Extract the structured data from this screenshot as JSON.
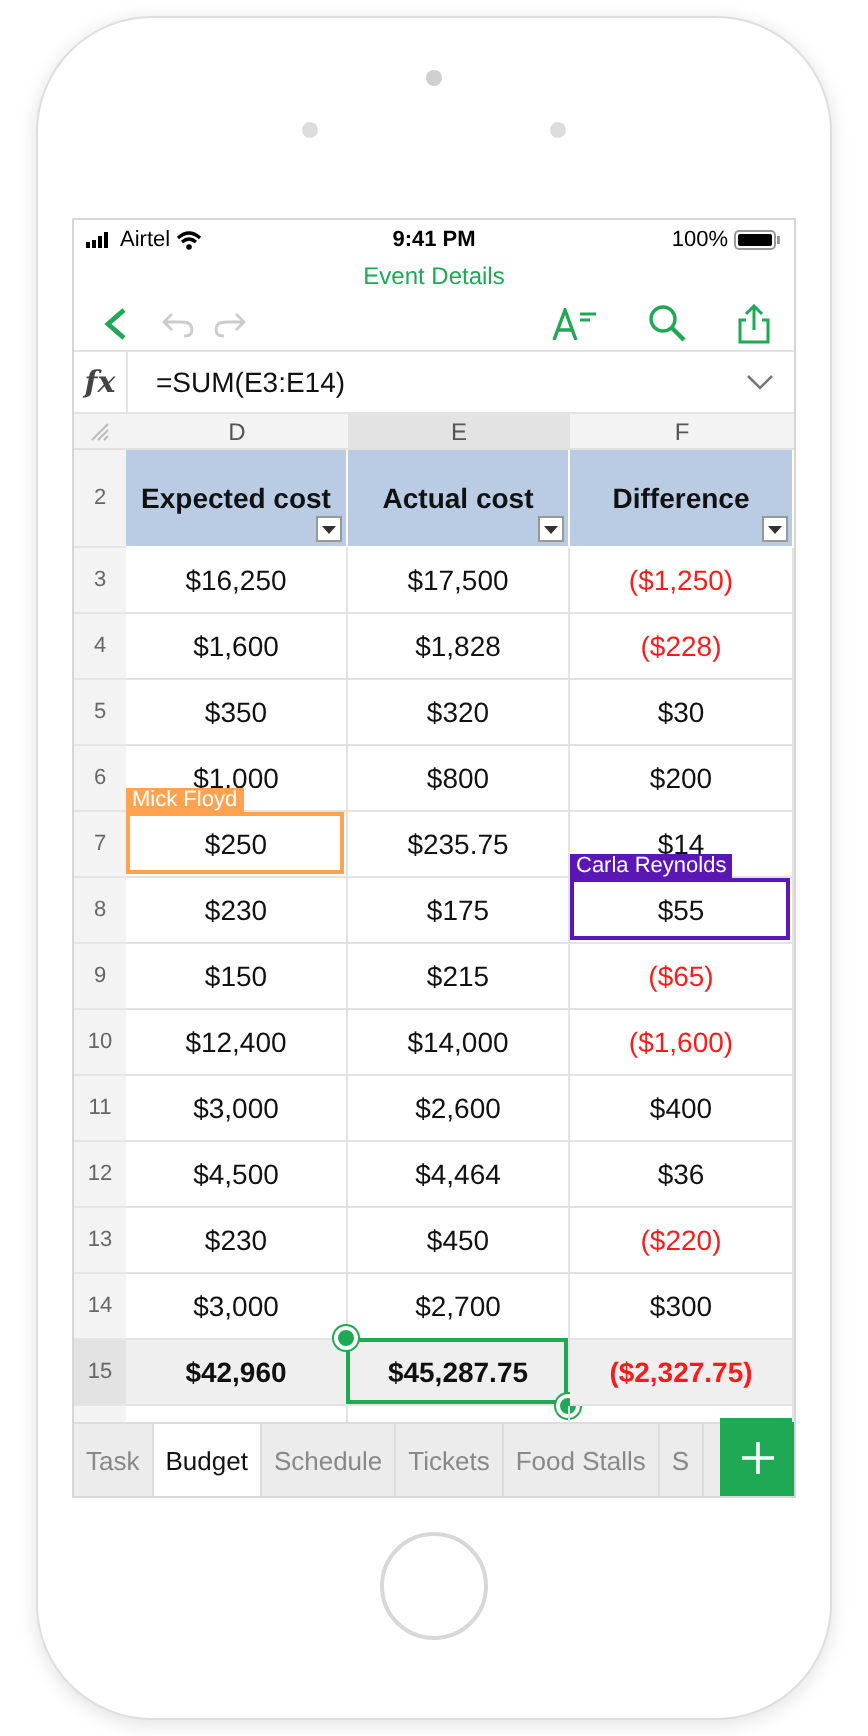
{
  "status_bar": {
    "carrier": "Airtel",
    "time": "9:41 PM",
    "battery": "100%"
  },
  "title": "Event Details",
  "formula_bar": {
    "label": "fx",
    "formula": "=SUM(E3:E14)"
  },
  "columns": [
    {
      "label": "D",
      "selected": false
    },
    {
      "label": "E",
      "selected": true
    },
    {
      "label": "F",
      "selected": false
    }
  ],
  "rows": [
    {
      "number": "2",
      "kind": "header",
      "selected": false,
      "cells": [
        {
          "text": "Expected cost",
          "selected": false
        },
        {
          "text": "Actual cost",
          "selected": false
        },
        {
          "text": "Difference",
          "selected": false
        }
      ]
    },
    {
      "number": "3",
      "kind": "data",
      "selected": false,
      "cells": [
        {
          "text": "$16,250",
          "selected": false
        },
        {
          "text": "$17,500",
          "selected": false
        },
        {
          "text": "($1,250)",
          "negative": true,
          "selected": false
        }
      ]
    },
    {
      "number": "4",
      "kind": "data",
      "selected": false,
      "cells": [
        {
          "text": "$1,600",
          "selected": false
        },
        {
          "text": "$1,828",
          "selected": false
        },
        {
          "text": "($228)",
          "negative": true,
          "selected": false
        }
      ]
    },
    {
      "number": "5",
      "kind": "data",
      "selected": false,
      "cells": [
        {
          "text": "$350",
          "selected": false
        },
        {
          "text": "$320",
          "selected": false
        },
        {
          "text": "$30",
          "selected": false
        }
      ]
    },
    {
      "number": "6",
      "kind": "data",
      "selected": false,
      "cells": [
        {
          "text": "$1,000",
          "selected": false
        },
        {
          "text": "$800",
          "selected": false
        },
        {
          "text": "$200",
          "selected": false
        }
      ]
    },
    {
      "number": "7",
      "kind": "data",
      "selected": false,
      "cells": [
        {
          "text": "$250",
          "selected": false,
          "collaborator": {
            "name": "Mick Floyd",
            "color": "#ffa351"
          }
        },
        {
          "text": "$235.75",
          "selected": false
        },
        {
          "text": "$14",
          "selected": false
        }
      ]
    },
    {
      "number": "8",
      "kind": "data",
      "selected": false,
      "cells": [
        {
          "text": "$230",
          "selected": false
        },
        {
          "text": "$175",
          "selected": false
        },
        {
          "text": "$55",
          "selected": false,
          "collaborator": {
            "name": "Carla Reynolds",
            "color": "#5b17b5"
          }
        }
      ]
    },
    {
      "number": "9",
      "kind": "data",
      "selected": false,
      "cells": [
        {
          "text": "$150",
          "selected": false
        },
        {
          "text": "$215",
          "selected": false
        },
        {
          "text": "($65)",
          "negative": true,
          "selected": false
        }
      ]
    },
    {
      "number": "10",
      "kind": "data",
      "selected": false,
      "cells": [
        {
          "text": "$12,400",
          "selected": false
        },
        {
          "text": "$14,000",
          "selected": false
        },
        {
          "text": "($1,600)",
          "negative": true,
          "selected": false
        }
      ]
    },
    {
      "number": "11",
      "kind": "data",
      "selected": false,
      "cells": [
        {
          "text": "$3,000",
          "selected": false
        },
        {
          "text": "$2,600",
          "selected": false
        },
        {
          "text": "$400",
          "selected": false
        }
      ]
    },
    {
      "number": "12",
      "kind": "data",
      "selected": false,
      "cells": [
        {
          "text": "$4,500",
          "selected": false
        },
        {
          "text": "$4,464",
          "selected": false
        },
        {
          "text": "$36",
          "selected": false
        }
      ]
    },
    {
      "number": "13",
      "kind": "data",
      "selected": false,
      "cells": [
        {
          "text": "$230",
          "selected": false
        },
        {
          "text": "$450",
          "selected": false
        },
        {
          "text": "($220)",
          "negative": true,
          "selected": false
        }
      ]
    },
    {
      "number": "14",
      "kind": "data",
      "selected": false,
      "cells": [
        {
          "text": "$3,000",
          "selected": false
        },
        {
          "text": "$2,700",
          "selected": false
        },
        {
          "text": "$300",
          "selected": false
        }
      ]
    },
    {
      "number": "15",
      "kind": "total",
      "selected": true,
      "cells": [
        {
          "text": "$42,960",
          "selected": false
        },
        {
          "text": "$45,287.75",
          "selected": true
        },
        {
          "text": "($2,327.75)",
          "negative": true,
          "selected": false
        }
      ]
    }
  ],
  "sheet_tabs": [
    {
      "label": "Task",
      "selected": false
    },
    {
      "label": "Budget",
      "selected": true
    },
    {
      "label": "Schedule",
      "selected": false
    },
    {
      "label": "Tickets",
      "selected": false
    },
    {
      "label": "Food Stalls",
      "selected": false
    },
    {
      "label": "S",
      "selected": false
    }
  ]
}
